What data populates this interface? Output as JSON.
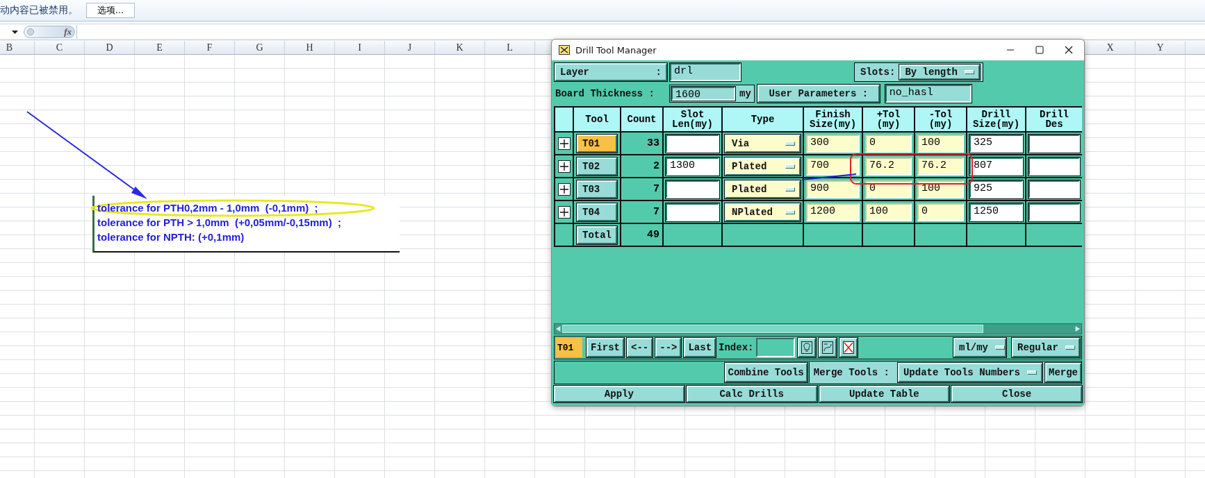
{
  "infobar": {
    "message": "动内容已被禁用。",
    "button": "选项..."
  },
  "formula_bar": {
    "function_label": "fx"
  },
  "sheet": {
    "columns_left": [
      "B",
      "C",
      "D",
      "E",
      "F",
      "G",
      "H",
      "I",
      "J",
      "K",
      "L"
    ],
    "columns_right": [
      "X",
      "Y"
    ]
  },
  "text_box": {
    "lines": [
      {
        "text": "tolerance for PTH0,2mm - 1,0mm  (-0,1mm)  ;",
        "highlighted": true
      },
      {
        "text": "tolerance for PTH > 1,0mm  (+0,05mm/-0,15mm)  ;",
        "highlighted": false
      },
      {
        "text": "tolerance for NPTH: (+0,1mm)",
        "highlighted": false
      }
    ]
  },
  "dialog": {
    "title": "Drill Tool Manager",
    "layer": {
      "label": "Layer",
      "separator": ":",
      "value": "drl"
    },
    "slots": {
      "label": "Slots:",
      "value": "By length"
    },
    "board_thickness": {
      "label": "Board Thickness :",
      "value": "1600",
      "unit": "my"
    },
    "user_parameters": {
      "label": "User Parameters :",
      "value": "no_hasl"
    },
    "table": {
      "columns": [
        {
          "lines": [
            "Tool"
          ]
        },
        {
          "lines": [
            "Count"
          ]
        },
        {
          "lines": [
            "Slot",
            "Len(my)"
          ]
        },
        {
          "lines": [
            "Type"
          ]
        },
        {
          "lines": [
            "Finish",
            "Size(my)"
          ]
        },
        {
          "lines": [
            "+Tol",
            "(my)"
          ]
        },
        {
          "lines": [
            "-Tol",
            "(my)"
          ]
        },
        {
          "lines": [
            "Drill",
            "Size(my)"
          ]
        },
        {
          "lines": [
            "Drill",
            "Des"
          ]
        }
      ],
      "rows": [
        {
          "tool": "T01",
          "selected": true,
          "count": "33",
          "type": "Via",
          "finish_size": "300",
          "plus_tol": "0",
          "minus_tol": "100",
          "drill_size": "325"
        },
        {
          "tool": "T02",
          "selected": false,
          "count": "2",
          "slot_len": "1300",
          "type": "Plated",
          "finish_size": "700",
          "plus_tol": "76.2",
          "minus_tol": "76.2",
          "drill_size": "807"
        },
        {
          "tool": "T03",
          "selected": false,
          "count": "7",
          "type": "Plated",
          "finish_size": "900",
          "plus_tol": "0",
          "minus_tol": "100",
          "drill_size": "925"
        },
        {
          "tool": "T04",
          "selected": false,
          "count": "7",
          "type": "NPlated",
          "finish_size": "1200",
          "plus_tol": "100",
          "minus_tol": "0",
          "drill_size": "1250"
        }
      ],
      "total": {
        "label": "Total",
        "count": "49"
      }
    },
    "navigation": {
      "current_tool": "T01",
      "buttons": [
        "First",
        "<--",
        "-->",
        "Last"
      ],
      "index_label": "Index:",
      "units": "ml/my",
      "mode": "Regular"
    },
    "merge": {
      "combine_button": "Combine Tools",
      "label": "Merge Tools :",
      "option": "Update Tools Numbers",
      "merge_button": "Merge"
    },
    "actions": [
      "Apply",
      "Calc Drills",
      "Update Table",
      "Close"
    ]
  }
}
